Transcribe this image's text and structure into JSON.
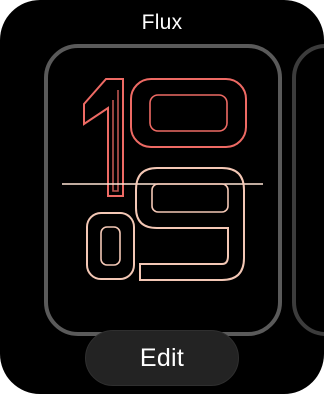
{
  "face": {
    "title": "Flux",
    "time": {
      "hour": "10",
      "minute": "09"
    }
  },
  "edit_button": {
    "label": "Edit"
  },
  "colors": {
    "hour_outline": "#ee6a64",
    "minute_outline": "#f3c7b5",
    "divider_line": "#ffe4d4",
    "card_border": "#5a5a5a",
    "button_bg": "#232323"
  }
}
